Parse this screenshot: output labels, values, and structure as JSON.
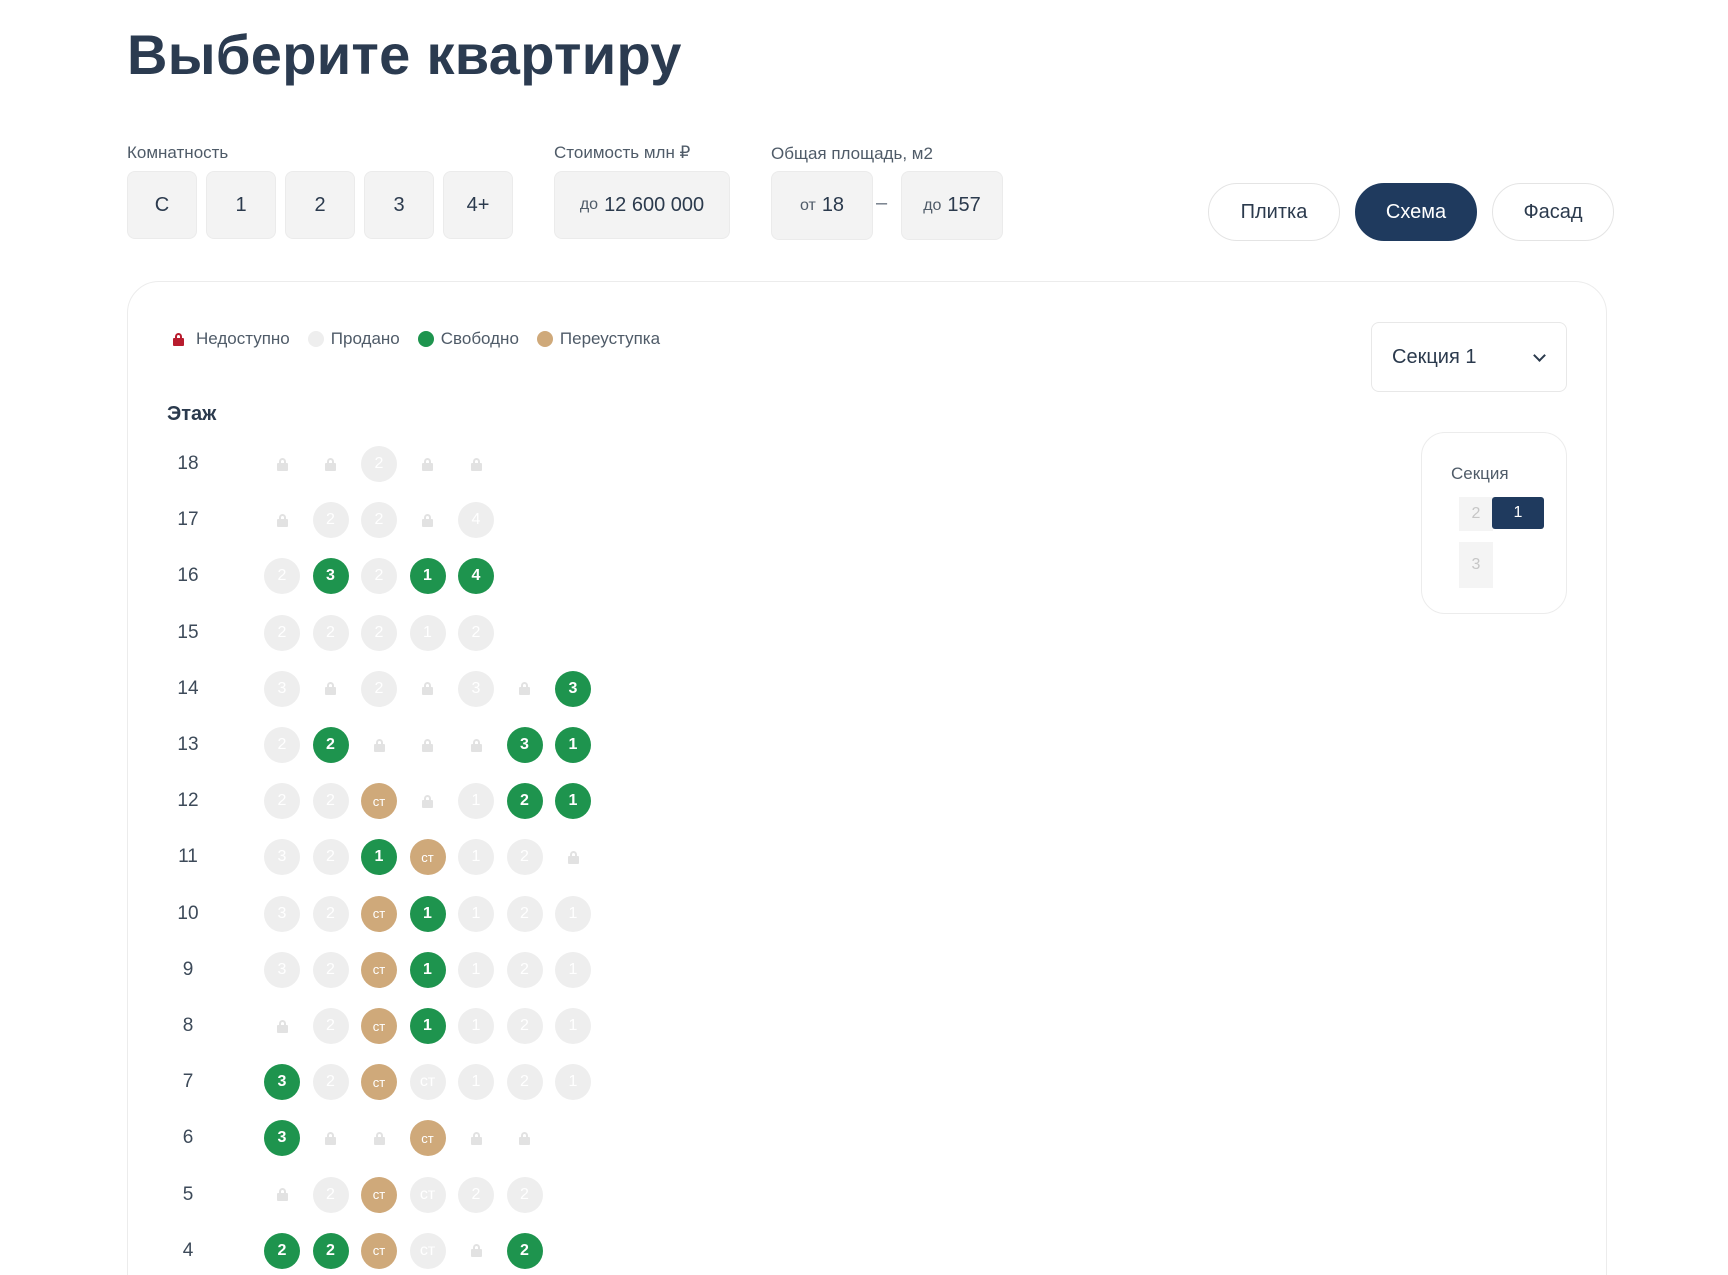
{
  "page_title": "Выберите квартиру",
  "filters": {
    "rooms_label": "Комнатность",
    "rooms": [
      "С",
      "1",
      "2",
      "3",
      "4+"
    ],
    "price_label": "Стоимость млн ₽",
    "price_prefix": "до",
    "price_value": "12 600 000",
    "area_label": "Общая площадь, м2",
    "area_from_prefix": "от",
    "area_from": "18",
    "area_dash": "–",
    "area_to_prefix": "до",
    "area_to": "157"
  },
  "views": {
    "tiles": "Плитка",
    "scheme": "Схема",
    "facade": "Фасад",
    "active": "scheme"
  },
  "legend": {
    "unavailable": "Недоступно",
    "sold": "Продано",
    "free": "Свободно",
    "assignment": "Переуступка"
  },
  "section_select": {
    "value": "Секция 1"
  },
  "floors_label": "Этаж",
  "grid": [
    {
      "floor": "18",
      "cells": [
        [
          "l",
          ""
        ],
        [
          "l",
          ""
        ],
        [
          "s",
          "2"
        ],
        [
          "l",
          ""
        ],
        [
          "l",
          ""
        ]
      ]
    },
    {
      "floor": "17",
      "cells": [
        [
          "l",
          ""
        ],
        [
          "s",
          "2"
        ],
        [
          "s",
          "2"
        ],
        [
          "l",
          ""
        ],
        [
          "s",
          "4"
        ]
      ]
    },
    {
      "floor": "16",
      "cells": [
        [
          "s",
          "2"
        ],
        [
          "f",
          "3"
        ],
        [
          "s",
          "2"
        ],
        [
          "f",
          "1"
        ],
        [
          "f",
          "4"
        ]
      ]
    },
    {
      "floor": "15",
      "cells": [
        [
          "s",
          "2"
        ],
        [
          "s",
          "2"
        ],
        [
          "s",
          "2"
        ],
        [
          "s",
          "1"
        ],
        [
          "s",
          "2"
        ]
      ]
    },
    {
      "floor": "14",
      "cells": [
        [
          "s",
          "3"
        ],
        [
          "l",
          ""
        ],
        [
          "s",
          "2"
        ],
        [
          "l",
          ""
        ],
        [
          "s",
          "3"
        ],
        [
          "l",
          ""
        ],
        [
          "f",
          "3"
        ]
      ]
    },
    {
      "floor": "13",
      "cells": [
        [
          "s",
          "2"
        ],
        [
          "f",
          "2"
        ],
        [
          "l",
          ""
        ],
        [
          "l",
          ""
        ],
        [
          "l",
          ""
        ],
        [
          "f",
          "3"
        ],
        [
          "f",
          "1"
        ]
      ]
    },
    {
      "floor": "12",
      "cells": [
        [
          "s",
          "2"
        ],
        [
          "s",
          "2"
        ],
        [
          "a",
          "ст"
        ],
        [
          "l",
          ""
        ],
        [
          "s",
          "1"
        ],
        [
          "f",
          "2"
        ],
        [
          "f",
          "1"
        ]
      ]
    },
    {
      "floor": "11",
      "cells": [
        [
          "s",
          "3"
        ],
        [
          "s",
          "2"
        ],
        [
          "f",
          "1"
        ],
        [
          "a",
          "ст"
        ],
        [
          "s",
          "1"
        ],
        [
          "s",
          "2"
        ],
        [
          "l",
          ""
        ]
      ]
    },
    {
      "floor": "10",
      "cells": [
        [
          "s",
          "3"
        ],
        [
          "s",
          "2"
        ],
        [
          "a",
          "ст"
        ],
        [
          "f",
          "1"
        ],
        [
          "s",
          "1"
        ],
        [
          "s",
          "2"
        ],
        [
          "s",
          "1"
        ]
      ]
    },
    {
      "floor": "9",
      "cells": [
        [
          "s",
          "3"
        ],
        [
          "s",
          "2"
        ],
        [
          "a",
          "ст"
        ],
        [
          "f",
          "1"
        ],
        [
          "s",
          "1"
        ],
        [
          "s",
          "2"
        ],
        [
          "s",
          "1"
        ]
      ]
    },
    {
      "floor": "8",
      "cells": [
        [
          "l",
          ""
        ],
        [
          "s",
          "2"
        ],
        [
          "a",
          "ст"
        ],
        [
          "f",
          "1"
        ],
        [
          "s",
          "1"
        ],
        [
          "s",
          "2"
        ],
        [
          "s",
          "1"
        ]
      ]
    },
    {
      "floor": "7",
      "cells": [
        [
          "f",
          "3"
        ],
        [
          "s",
          "2"
        ],
        [
          "a",
          "ст"
        ],
        [
          "s",
          "ст"
        ],
        [
          "s",
          "1"
        ],
        [
          "s",
          "2"
        ],
        [
          "s",
          "1"
        ]
      ]
    },
    {
      "floor": "6",
      "cells": [
        [
          "f",
          "3"
        ],
        [
          "l",
          ""
        ],
        [
          "l",
          ""
        ],
        [
          "a",
          "ст"
        ],
        [
          "l",
          ""
        ],
        [
          "l",
          ""
        ]
      ]
    },
    {
      "floor": "5",
      "cells": [
        [
          "l",
          ""
        ],
        [
          "s",
          "2"
        ],
        [
          "a",
          "ст"
        ],
        [
          "s",
          "ст"
        ],
        [
          "s",
          "2"
        ],
        [
          "s",
          "2"
        ]
      ]
    },
    {
      "floor": "4",
      "cells": [
        [
          "f",
          "2"
        ],
        [
          "f",
          "2"
        ],
        [
          "a",
          "ст"
        ],
        [
          "s",
          "ст"
        ],
        [
          "l",
          ""
        ],
        [
          "f",
          "2"
        ]
      ]
    }
  ],
  "sections_card": {
    "title": "Секция",
    "items": [
      "1",
      "2",
      "3"
    ],
    "active": "1"
  },
  "colors": {
    "free": "#1e944e",
    "assignment": "#cfa97a",
    "sold": "#eeeeee",
    "unavailable": "#b81c2e",
    "accent": "#1f3a5e"
  }
}
